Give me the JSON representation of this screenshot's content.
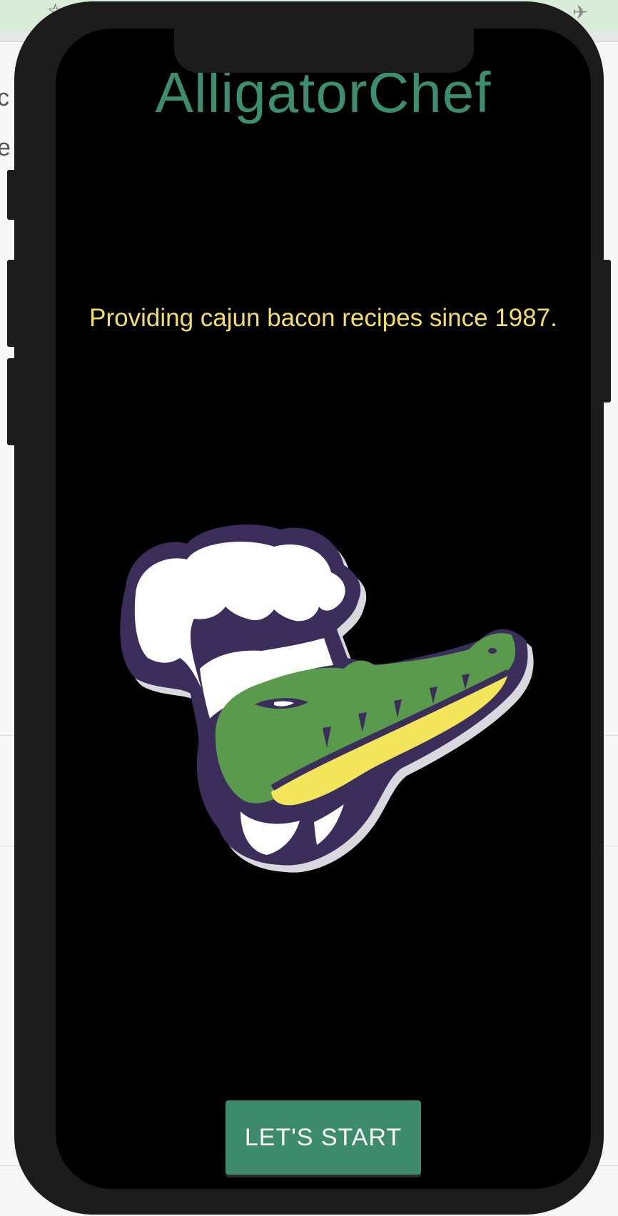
{
  "app": {
    "title": "AlligatorChef",
    "tagline": "Providing cajun bacon recipes since 1987.",
    "start_button_label": "LET'S START"
  },
  "browser_background": {
    "fragment_1": "c",
    "fragment_2": "e"
  },
  "icons": {
    "star": "star-icon",
    "airplane": "airplane-icon",
    "logo": "alligator-chef-logo"
  },
  "colors": {
    "title": "#3b8e6e",
    "tagline": "#f2df63",
    "button": "#3c8b6c",
    "logo_outline": "#3b2e5a",
    "logo_green": "#5a9a4c",
    "logo_yellow": "#f2e55a"
  }
}
